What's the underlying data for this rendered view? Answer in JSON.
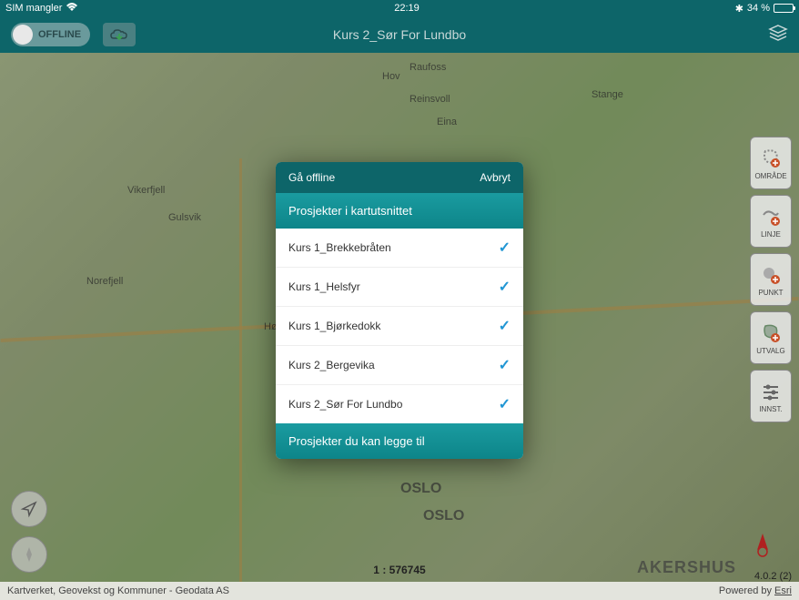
{
  "status_bar": {
    "carrier": "SIM mangler",
    "time": "22:19",
    "bluetooth": "✱",
    "battery_pct": "34 %"
  },
  "header": {
    "offline_label": "OFFLINE",
    "title": "Kurs 2_Sør For Lundbo"
  },
  "tools": {
    "omrade": "OMRÅDE",
    "linje": "LINJE",
    "punkt": "PUNKT",
    "utvalg": "UTVALG",
    "innst": "INNST."
  },
  "modal": {
    "go_offline": "Gå offline",
    "cancel": "Avbryt",
    "section1_title": "Prosjekter i kartutsnittet",
    "section2_title": "Prosjekter du kan legge til",
    "projects": [
      {
        "name": "Kurs 1_Brekkebråten"
      },
      {
        "name": "Kurs 1_Helsfyr"
      },
      {
        "name": "Kurs 1_Bjørkedokk"
      },
      {
        "name": "Kurs 2_Bergevika"
      },
      {
        "name": "Kurs 2_Sør For Lundbo"
      }
    ]
  },
  "map": {
    "scale": "1 : 576745",
    "version": "4.0.2 (2)",
    "labels": {
      "oslo": "OSLO",
      "oslo2": "OSLO",
      "akershus": "AKERSHUS",
      "raufoss": "Raufoss",
      "hov": "Hov",
      "reinsvoll": "Reinsvoll",
      "eina": "Eina",
      "stange": "Stange",
      "vikerfjell": "Vikerfjell",
      "gulsvik": "Gulsvik",
      "norefjell": "Norefjell",
      "honefoss": "Hønefoss"
    }
  },
  "footer": {
    "attribution": "Kartverket, Geovekst og Kommuner - Geodata AS",
    "powered": "Powered by",
    "esri": "Esri"
  }
}
